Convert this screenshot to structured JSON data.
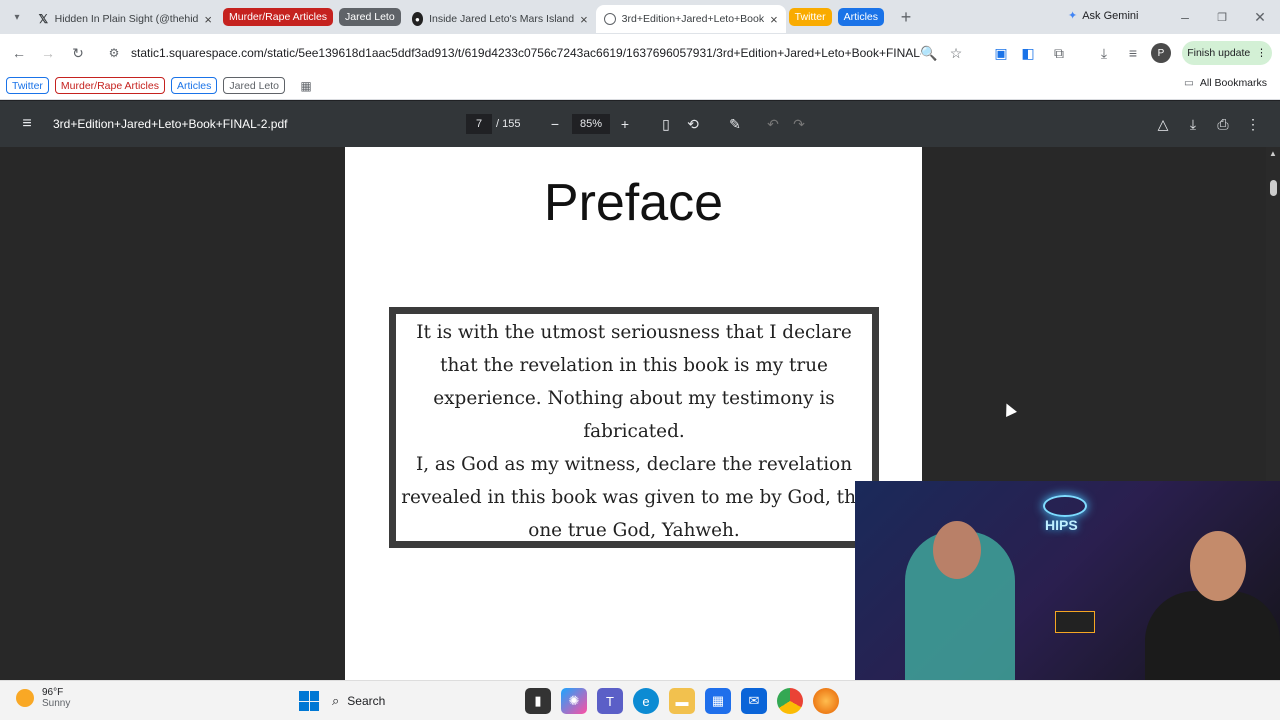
{
  "tabs": [
    {
      "label": "Hidden In Plain Sight (@thehid",
      "icon": "x-logo-icon"
    },
    {
      "label": "Inside Jared Leto's Mars Island",
      "icon": "site-icon"
    },
    {
      "label": "3rd+Edition+Jared+Leto+Book",
      "icon": "globe-icon",
      "active": true
    }
  ],
  "tab_groups": [
    {
      "label": "Murder/Rape Articles",
      "color": "#c5221f"
    },
    {
      "label": "Jared Leto",
      "color": "#5f6368"
    },
    {
      "label": "Twitter",
      "color": "#f9ab00"
    },
    {
      "label": "Articles",
      "color": "#1a73e8"
    }
  ],
  "ask_gemini": "Ask Gemini",
  "url": "static1.squarespace.com/static/5ee139618d1aac5ddf3ad913/t/619d4233c0756c7243ac6619/1637696057931/3rd+Edition+Jared+Leto+Book+FINAL-2...",
  "finish_update": "Finish update",
  "bookmarks": [
    {
      "label": "Twitter",
      "color": "#1a73e8"
    },
    {
      "label": "Murder/Rape Articles",
      "color": "#c5221f"
    },
    {
      "label": "Articles",
      "color": "#1a73e8"
    },
    {
      "label": "Jared Leto",
      "color": "#5f6368"
    }
  ],
  "all_bookmarks": "All Bookmarks",
  "pdf": {
    "filename": "3rd+Edition+Jared+Leto+Book+FINAL-2.pdf",
    "page": "7",
    "total": "/ 155",
    "zoom": "85%"
  },
  "page_content": {
    "title": "Preface",
    "para1": "It is with the utmost seriousness that I declare that the revelation in this book is my true experience. Nothing about my testimony is fabricated.",
    "para2": "I, as God as my witness, declare the revelation revealed in this book was given to me by God, the one true God, Yahweh."
  },
  "taskbar": {
    "temp": "96°F",
    "weather": "Sunny",
    "search": "Search"
  },
  "webcam": {
    "sign": "HIPS"
  }
}
